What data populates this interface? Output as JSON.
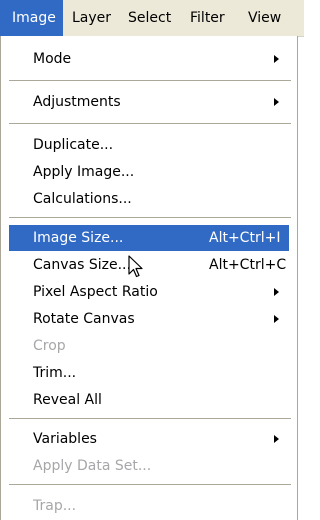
{
  "menubar": {
    "items": [
      {
        "label": "Image",
        "active": true
      },
      {
        "label": "Layer"
      },
      {
        "label": "Select"
      },
      {
        "label": "Filter"
      },
      {
        "label": "View"
      }
    ]
  },
  "menu": {
    "items": [
      {
        "label": "Mode",
        "submenu": true
      },
      {
        "label": "Adjustments",
        "submenu": true
      },
      {
        "label": "Duplicate..."
      },
      {
        "label": "Apply Image..."
      },
      {
        "label": "Calculations..."
      },
      {
        "label": "Image Size...",
        "shortcut": "Alt+Ctrl+I",
        "highlighted": true
      },
      {
        "label": "Canvas Size...",
        "shortcut": "Alt+Ctrl+C"
      },
      {
        "label": "Pixel Aspect Ratio",
        "submenu": true
      },
      {
        "label": "Rotate Canvas",
        "submenu": true
      },
      {
        "label": "Crop",
        "disabled": true
      },
      {
        "label": "Trim..."
      },
      {
        "label": "Reveal All"
      },
      {
        "label": "Variables",
        "submenu": true
      },
      {
        "label": "Apply Data Set...",
        "disabled": true
      },
      {
        "label": "Trap...",
        "disabled": true
      }
    ]
  },
  "colors": {
    "highlight": "#316ac5",
    "disabled_text": "#a7a6aa",
    "menubar_bg": "#ece9d8"
  }
}
